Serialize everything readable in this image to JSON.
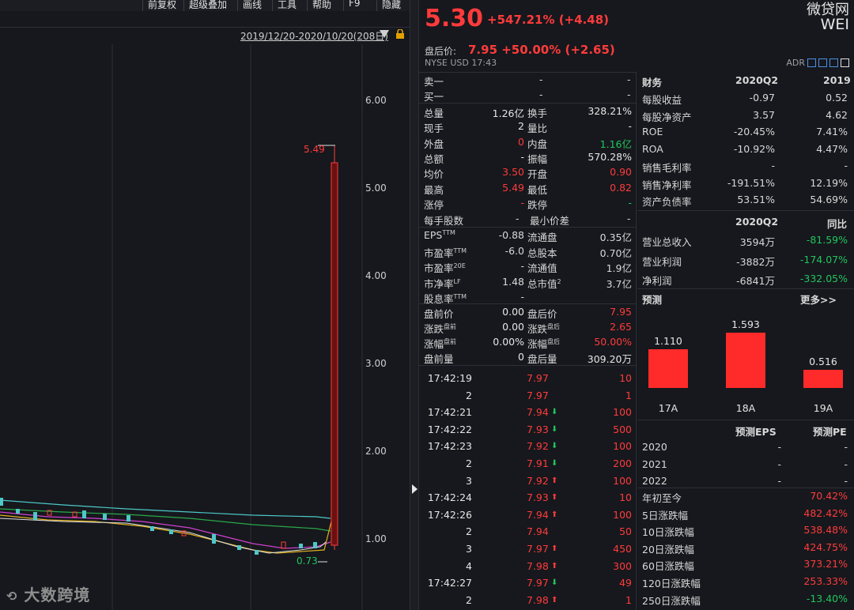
{
  "toolbar": {
    "items": [
      "前复权",
      "超级叠加",
      "画线",
      "工具",
      "帮助",
      "F9",
      "隐藏"
    ]
  },
  "chart": {
    "range_label": "2019/12/20-2020/10/20(208日)",
    "y_ticks": [
      "6.00",
      "5.00",
      "4.00",
      "3.00",
      "2.00",
      "1.00"
    ],
    "high_marker": "5.49",
    "low_marker": "0.73"
  },
  "watermark": "大数跨境",
  "quote": {
    "price": "5.30",
    "change": "+547.21% (+4.48)",
    "name": "微贷网",
    "code": "WEI",
    "after_label": "盘后价:",
    "after_price": "7.95 +50.00% (+2.65)",
    "exchange_line": "NYSE  USD  17:43",
    "adr_label": "ADR"
  },
  "orderbook": [
    {
      "label": "卖一",
      "price": "-",
      "vol": "-"
    },
    {
      "label": "买一",
      "price": "-",
      "vol": "-"
    }
  ],
  "stats": [
    {
      "l1": "总量",
      "v1": "1.26亿",
      "c1": "white",
      "l2": "换手",
      "v2": "328.21%",
      "c2": "white"
    },
    {
      "l1": "现手",
      "v1": "2",
      "c1": "white",
      "l2": "量比",
      "v2": "-",
      "c2": "white"
    },
    {
      "l1": "外盘",
      "v1": "0",
      "c1": "red",
      "l2": "内盘",
      "v2": "1.16亿",
      "c2": "green"
    },
    {
      "l1": "总额",
      "v1": "-",
      "c1": "white",
      "l2": "振幅",
      "v2": "570.28%",
      "c2": "white"
    },
    {
      "l1": "均价",
      "v1": "3.50",
      "c1": "red",
      "l2": "开盘",
      "v2": "0.90",
      "c2": "red"
    },
    {
      "l1": "最高",
      "v1": "5.49",
      "c1": "red",
      "l2": "最低",
      "v2": "0.82",
      "c2": "red"
    },
    {
      "l1": "涨停",
      "v1": "-",
      "c1": "red",
      "l2": "跌停",
      "v2": "-",
      "c2": "green"
    }
  ],
  "share": {
    "label1": "每手股数",
    "v1": "-",
    "label2": "最小价差",
    "v2": "-"
  },
  "valuation": [
    {
      "l1": "EPS",
      "sup1": "TTM",
      "v1": "-0.88",
      "l2": "流通盘",
      "sup2": "",
      "v2": "0.35亿"
    },
    {
      "l1": "市盈率",
      "sup1": "TTM",
      "v1": "-6.0",
      "l2": "总股本",
      "sup2": "",
      "v2": "0.70亿"
    },
    {
      "l1": "市盈率",
      "sup1": "20E",
      "v1": "-",
      "l2": "流通值",
      "sup2": "",
      "v2": "1.9亿"
    },
    {
      "l1": "市净率",
      "sup1": "LF",
      "v1": "1.48",
      "l2": "总市值",
      "sup2": "2",
      "v2": "3.7亿"
    },
    {
      "l1": "股息率",
      "sup1": "TTM",
      "v1": "-",
      "l2": "",
      "sup2": "",
      "v2": ""
    }
  ],
  "prepost": [
    {
      "l1": "盘前价",
      "sup1": "",
      "v1": "0.00",
      "c1": "white",
      "l2": "盘后价",
      "sup2": "",
      "v2": "7.95",
      "c2": "red"
    },
    {
      "l1": "涨跌",
      "sup1": "盘前",
      "v1": "0.00",
      "c1": "white",
      "l2": "涨跌",
      "sup2": "盘后",
      "v2": "2.65",
      "c2": "red"
    },
    {
      "l1": "涨幅",
      "sup1": "盘前",
      "v1": "0.00%",
      "c1": "white",
      "l2": "涨幅",
      "sup2": "盘后",
      "v2": "50.00%",
      "c2": "red"
    },
    {
      "l1": "盘前量",
      "sup1": "",
      "v1": "0",
      "c1": "white",
      "l2": "盘后量",
      "sup2": "",
      "v2": "309.20万",
      "c2": "white"
    }
  ],
  "ticks": [
    {
      "time": "17:42:19",
      "price": "7.97",
      "dir": "",
      "vol": "10"
    },
    {
      "time": "2",
      "price": "7.97",
      "dir": "",
      "vol": "1"
    },
    {
      "time": "17:42:21",
      "price": "7.94",
      "dir": "down",
      "vol": "100"
    },
    {
      "time": "17:42:22",
      "price": "7.93",
      "dir": "down",
      "vol": "500"
    },
    {
      "time": "17:42:23",
      "price": "7.92",
      "dir": "down",
      "vol": "100"
    },
    {
      "time": "2",
      "price": "7.91",
      "dir": "down",
      "vol": "200"
    },
    {
      "time": "3",
      "price": "7.92",
      "dir": "up",
      "vol": "100"
    },
    {
      "time": "17:42:24",
      "price": "7.93",
      "dir": "up",
      "vol": "10"
    },
    {
      "time": "17:42:26",
      "price": "7.94",
      "dir": "up",
      "vol": "100"
    },
    {
      "time": "2",
      "price": "7.94",
      "dir": "",
      "vol": "50"
    },
    {
      "time": "3",
      "price": "7.97",
      "dir": "up",
      "vol": "450"
    },
    {
      "time": "4",
      "price": "7.98",
      "dir": "up",
      "vol": "300"
    },
    {
      "time": "17:42:27",
      "price": "7.97",
      "dir": "down",
      "vol": "49"
    },
    {
      "time": "2",
      "price": "7.98",
      "dir": "up",
      "vol": "1"
    }
  ],
  "financials": {
    "header": {
      "title": "财务",
      "c1": "2020Q2",
      "c2": "2019"
    },
    "rows": [
      {
        "label": "每股收益",
        "v1": "-0.97",
        "v2": "0.52"
      },
      {
        "label": "每股净资产",
        "v1": "3.57",
        "v2": "4.62"
      },
      {
        "label": "ROE",
        "v1": "-20.45%",
        "v2": "7.41%"
      },
      {
        "label": "ROA",
        "v1": "-10.92%",
        "v2": "4.47%"
      },
      {
        "label": "销售毛利率",
        "v1": "-",
        "v2": "-"
      },
      {
        "label": "销售净利率",
        "v1": "-191.51%",
        "v2": "12.19%"
      },
      {
        "label": "资产负债率",
        "v1": "53.51%",
        "v2": "54.69%"
      }
    ],
    "income_header": {
      "c1": "2020Q2",
      "c2": "同比"
    },
    "income": [
      {
        "label": "营业总收入",
        "v1": "3594万",
        "v2": "-81.59%"
      },
      {
        "label": "营业利润",
        "v1": "-3882万",
        "v2": "-174.07%"
      },
      {
        "label": "净利润",
        "v1": "-6841万",
        "v2": "-332.05%"
      }
    ]
  },
  "forecast": {
    "title": "预测",
    "more": "更多>>",
    "chart_data": {
      "type": "bar",
      "categories": [
        "17A",
        "18A",
        "19A"
      ],
      "values": [
        1.11,
        1.593,
        0.516
      ],
      "labels": [
        "1.110",
        "1.593",
        "0.516"
      ],
      "color": "#ff2a2a"
    },
    "table_header": {
      "c1": "预测EPS",
      "c2": "预测PE"
    },
    "table": [
      {
        "year": "2020",
        "eps": "-",
        "pe": "-"
      },
      {
        "year": "2021",
        "eps": "-",
        "pe": "-"
      },
      {
        "year": "2022",
        "eps": "-",
        "pe": "-"
      }
    ]
  },
  "performance": [
    {
      "label": "年初至今",
      "value": "70.42%",
      "color": "red"
    },
    {
      "label": "5日涨跌幅",
      "value": "482.42%",
      "color": "red"
    },
    {
      "label": "10日涨跌幅",
      "value": "538.48%",
      "color": "red"
    },
    {
      "label": "20日涨跌幅",
      "value": "424.75%",
      "color": "red"
    },
    {
      "label": "60日涨跌幅",
      "value": "373.21%",
      "color": "red"
    },
    {
      "label": "120日涨跌幅",
      "value": "253.33%",
      "color": "red"
    },
    {
      "label": "250日涨跌幅",
      "value": "-13.40%",
      "color": "green"
    }
  ]
}
